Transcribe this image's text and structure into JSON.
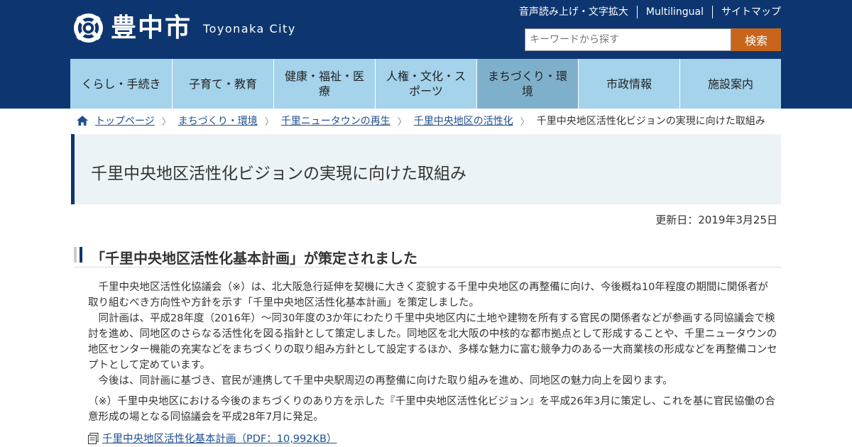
{
  "header": {
    "logo_jp": "豊中市",
    "logo_en": "Toyonaka City",
    "util_links": [
      "音声読み上げ・文字拡大",
      "Multilingual",
      "サイトマップ"
    ],
    "search": {
      "placeholder": "キーワードから探す",
      "button": "検索"
    }
  },
  "nav": [
    "くらし・手続き",
    "子育て・教育",
    "健康・福祉・医療",
    "人権・文化・スポーツ",
    "まちづくり・環境",
    "市政情報",
    "施設案内"
  ],
  "breadcrumb": [
    "トップページ",
    "まちづくり・環境",
    "千里ニュータウンの再生",
    "千里中央地区の活性化"
  ],
  "breadcrumb_current": "千里中央地区活性化ビジョンの実現に向けた取組み",
  "page": {
    "title": "千里中央地区活性化ビジョンの実現に向けた取組み",
    "updated": "更新日：2019年3月25日",
    "section_heading": "「千里中央地区活性化基本計画」が策定されました",
    "paragraphs": [
      "千里中央地区活性化協議会（※）は、北大阪急行延伸を契機に大きく変貌する千里中央地区の再整備に向け、今後概ね10年程度の期間に関係者が取り組むべき方向性や方針を示す「千里中央地区活性化基本計画」を策定しました。",
      "同計画は、平成28年度（2016年）～同30年度の3か年にわたり千里中央地区内に土地や建物を所有する官民の関係者などが参画する同協議会で検討を進め、同地区のさらなる活性化を図る指針として策定しました。同地区を北大阪の中核的な都市拠点として形成することや、千里ニュータウンの地区センター機能の充実などをまちづくりの取り組み方針として設定するほか、多様な魅力に富む競争力のある一大商業核の形成などを再整備コンセプトとして定めています。",
      "今後は、同計画に基づき、官民が連携して千里中央駅周辺の再整備に向けた取り組みを進め、同地区の魅力向上を図ります。"
    ],
    "note": "（※）千里中央地区における今後のまちづくりのあり方を示した『千里中央地区活性化ビジョン』を平成26年3月に策定し、これを基に官民協働の合意形成の場となる同協議会を平成28年7月に発足。",
    "pdf_link": "千里中央地区活性化基本計画（PDF：10,992KB）"
  },
  "colors": {
    "header_bg": "#0d3670",
    "nav_bg": "#a4d3eb",
    "nav_active": "#7fb0cb",
    "search_button": "#c7651a",
    "link": "#1f4f8e"
  },
  "icons": [
    "toyonaka-logo-icon",
    "home-icon",
    "chevron-right-icon",
    "pdf-icon"
  ]
}
